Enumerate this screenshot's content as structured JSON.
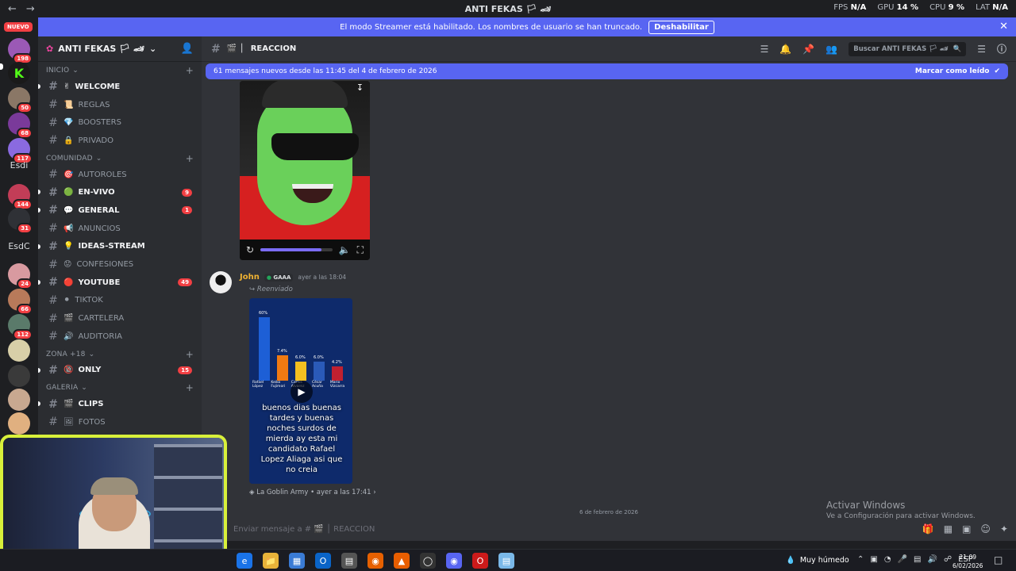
{
  "window": {
    "title": "ANTI FEKAS 🏳 🏎",
    "stats": [
      {
        "label": "FPS",
        "value": "N/A"
      },
      {
        "label": "GPU",
        "value": "14 %"
      },
      {
        "label": "CPU",
        "value": "9 %"
      },
      {
        "label": "LAT",
        "value": "N/A"
      }
    ]
  },
  "banner": {
    "text": "El modo Streamer está habilitado. Los nombres de usuario se han truncado.",
    "button": "Deshabilitar"
  },
  "rail": {
    "nuevo": "NUEVO",
    "text_items": [
      "Esdi",
      "EsdC"
    ],
    "badges": [
      "198",
      "50",
      "68",
      "117",
      "144",
      "31",
      "24",
      "66",
      "112"
    ]
  },
  "server": {
    "name": "ANTI FEKAS 🏳 🏎",
    "categories": [
      {
        "label": "INICIO",
        "channels": [
          {
            "icon": "✌",
            "name": "WELCOME",
            "bold": true,
            "dot": true
          },
          {
            "icon": "📜",
            "name": "REGLAS",
            "bold": false
          },
          {
            "icon": "💎",
            "name": "BOOSTERS",
            "bold": false
          },
          {
            "icon": "🔒",
            "name": "PRIVADO",
            "bold": false
          }
        ]
      },
      {
        "label": "COMUNIDAD",
        "channels": [
          {
            "icon": "🎯",
            "name": "AUTOROLES",
            "bold": false
          },
          {
            "icon": "🟢",
            "name": "EN-VIVO",
            "bold": true,
            "dot": true,
            "badge": "9"
          },
          {
            "icon": "💬",
            "name": "GENERAL",
            "bold": true,
            "dot": true,
            "badge": "1"
          },
          {
            "icon": "📢",
            "name": "ANUNCIOS",
            "bold": false
          },
          {
            "icon": "💡",
            "name": "IDEAS-STREAM",
            "bold": true,
            "dot": true
          },
          {
            "icon": "😟",
            "name": "CONFESIONES",
            "bold": false
          },
          {
            "icon": "🔴",
            "name": "YOUTUBE",
            "bold": true,
            "dot": true,
            "badge": "49"
          },
          {
            "icon": "⚫",
            "name": "TIKTOK",
            "bold": false
          },
          {
            "icon": "🎬",
            "name": "CARTELERA",
            "bold": false
          },
          {
            "icon": "🔊",
            "name": "AUDITORIA",
            "bold": false
          }
        ]
      },
      {
        "label": "ZONA +18",
        "channels": [
          {
            "icon": "🔞",
            "name": "ONLY",
            "bold": true,
            "dot": true,
            "badge": "15"
          }
        ]
      },
      {
        "label": "GALERIA",
        "channels": [
          {
            "icon": "🎬",
            "name": "CLIPS",
            "bold": true,
            "dot": true
          },
          {
            "icon": "🖼",
            "name": "FOTOS",
            "bold": false
          }
        ]
      }
    ]
  },
  "channel": {
    "name": "REACCION",
    "search_placeholder": "Buscar ANTI FEKAS 🏳 🏎"
  },
  "new_messages": {
    "text": "61 mensajes nuevos desde las 11:45 del 4 de febrero de 2026",
    "mark_read": "Marcar como leído"
  },
  "video1": {
    "progress": 0.85
  },
  "message": {
    "author": "John",
    "tag": "GAAA",
    "time": "ayer a las 18:04",
    "forwarded": "Reenviado",
    "overlay_text": "buenos dias buenas tardes y buenas noches surdos de mierda ay esta mi candidato Rafael Lopez Aliaga asi que no creia",
    "chart_labels": [
      "60%",
      "7.4%",
      "6.0%",
      "6.0%",
      "4.2%"
    ],
    "chart_names": [
      "Rafael López",
      "Keiko Fujimori",
      "Carlos Alvarez",
      "César Acuña",
      "Mario Vizcarra"
    ],
    "source": "La Goblin Army",
    "source_time": "ayer a las 17:41"
  },
  "divider": "6 de febrero de 2026",
  "composer": {
    "placeholder": "Enviar mensaje a # 🎬 │ REACCION"
  },
  "watermark": {
    "line1": "Activar Windows",
    "line2": "Ve a Configuración para activar Windows."
  },
  "taskbar": {
    "weather": "Muy húmedo",
    "lang": "ESP",
    "time": "21:09",
    "date": "6/02/2026"
  }
}
